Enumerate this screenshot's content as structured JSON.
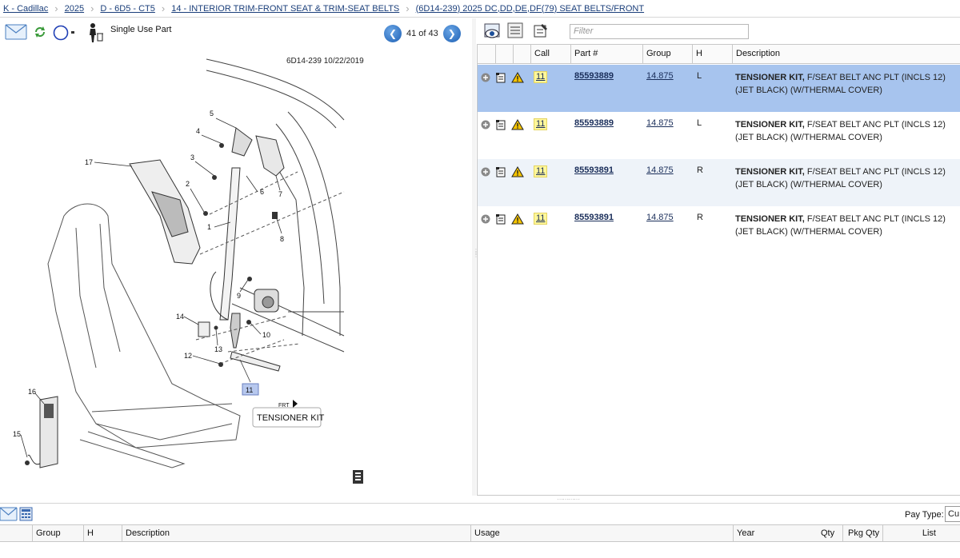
{
  "breadcrumb": [
    "K - Cadillac",
    "2025",
    "D - 6D5 - CT5",
    "14 - INTERIOR TRIM-FRONT SEAT & TRIM-SEAT BELTS",
    "(6D14-239)  2025  DC,DD,DE,DF(79)  SEAT BELTS/FRONT"
  ],
  "toolbar": {
    "single_use_label": "Single Use Part",
    "page_text": "41 of 43",
    "icons": [
      "email-icon",
      "refresh-icon",
      "circle-icon",
      "single-use-person-icon"
    ]
  },
  "diagram": {
    "id_date": "6D14-239  10/22/2019",
    "callouts": [
      "1",
      "2",
      "3",
      "4",
      "5",
      "6",
      "7",
      "8",
      "9",
      "10",
      "11",
      "12",
      "13",
      "14",
      "15",
      "16",
      "17"
    ],
    "highlighted_callout": "11",
    "label": "TENSIONER KIT",
    "front_label": "FRT"
  },
  "parts_toolbar": {
    "filter_placeholder": "Filter",
    "icons": [
      "view-diagram-icon",
      "list-icon",
      "notes-icon"
    ]
  },
  "parts_table": {
    "headers": {
      "call": "Call",
      "part": "Part #",
      "group": "Group",
      "h": "H",
      "description": "Description"
    },
    "rows": [
      {
        "call": "11",
        "part": "85593889",
        "group": "14.875",
        "h": "L",
        "desc_bold": "TENSIONER KIT,",
        "desc": " F/SEAT BELT ANC PLT (INCLS 12) (JET BLACK) (W/THERMAL COVER)",
        "selected": true
      },
      {
        "call": "11",
        "part": "85593889",
        "group": "14.875",
        "h": "L",
        "desc_bold": "TENSIONER KIT,",
        "desc": " F/SEAT BELT ANC PLT (INCLS 12) (JET BLACK) (W/THERMAL COVER)",
        "selected": false
      },
      {
        "call": "11",
        "part": "85593891",
        "group": "14.875",
        "h": "R",
        "desc_bold": "TENSIONER KIT,",
        "desc": " F/SEAT BELT ANC PLT (INCLS 12) (JET BLACK) (W/THERMAL COVER)",
        "selected": false
      },
      {
        "call": "11",
        "part": "85593891",
        "group": "14.875",
        "h": "R",
        "desc_bold": "TENSIONER KIT,",
        "desc": " F/SEAT BELT ANC PLT (INCLS 12) (JET BLACK) (W/THERMAL COVER)",
        "selected": false
      }
    ]
  },
  "bottom": {
    "pay_type_label": "Pay Type:",
    "pay_type_value": "Cu",
    "headers": {
      "group": "Group",
      "h": "H",
      "description": "Description",
      "usage": "Usage",
      "year": "Year",
      "qty": "Qty",
      "pkg_qty": "Pkg Qty",
      "list": "List"
    }
  },
  "colors": {
    "selected_row": "#a7c4ee",
    "alt_row": "#eef3f9",
    "call_badge": "#fff79a",
    "link": "#1a2e5a"
  }
}
